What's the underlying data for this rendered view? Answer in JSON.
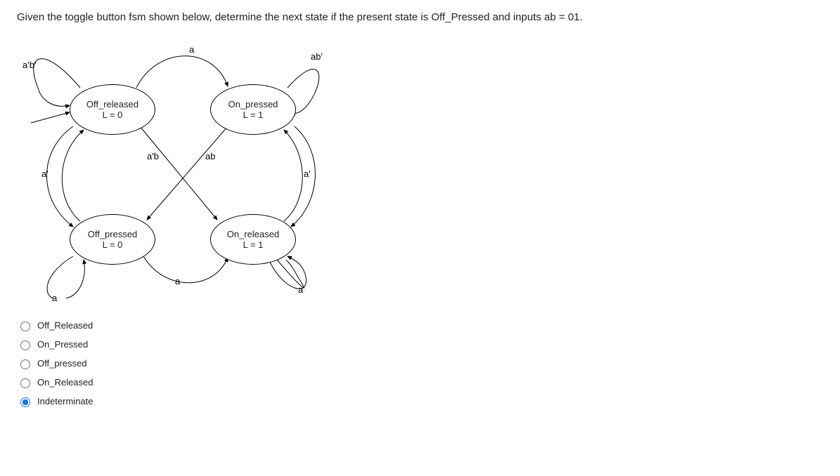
{
  "question": "Given the toggle button fsm shown below, determine the next state if the present state is Off_Pressed and inputs ab = 01.",
  "states": {
    "off_released": {
      "name": "Off_released",
      "output": "L = 0"
    },
    "on_pressed": {
      "name": "On_pressed",
      "output": "L = 1"
    },
    "off_pressed": {
      "name": "Off_pressed",
      "output": "L = 0"
    },
    "on_released": {
      "name": "On_released",
      "output": "L = 1"
    }
  },
  "edge_labels": {
    "selfloop_off_released": "a'b'",
    "top_off_to_on": "a",
    "selfloop_on_pressed": "ab'",
    "left_off_released_to_off_pressed": "a'",
    "cross_a_prime_b": "a'b",
    "cross_ab": "ab",
    "right_on_pressed_to_on_released": "a'",
    "selfloop_off_pressed": "a",
    "bottom_off_to_on": "a",
    "selfloop_on_released": "a'"
  },
  "options": [
    {
      "label": "Off_Released",
      "selected": false
    },
    {
      "label": "On_Pressed",
      "selected": false
    },
    {
      "label": "Off_pressed",
      "selected": false
    },
    {
      "label": "On_Released",
      "selected": false
    },
    {
      "label": "Indeterminate",
      "selected": true
    }
  ]
}
